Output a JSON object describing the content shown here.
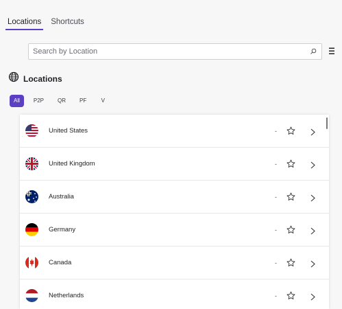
{
  "tabs": [
    {
      "label": "Locations",
      "active": true
    },
    {
      "label": "Shortcuts",
      "active": false
    }
  ],
  "search": {
    "placeholder": "Search by Location",
    "value": ""
  },
  "section": {
    "title": "Locations",
    "icon": "globe-icon"
  },
  "filters": [
    {
      "label": "All",
      "active": true
    },
    {
      "label": "P2P",
      "active": false
    },
    {
      "label": "QR",
      "active": false
    },
    {
      "label": "PF",
      "active": false
    },
    {
      "label": "V",
      "active": false
    }
  ],
  "locations": [
    {
      "name": "United States",
      "status": "-",
      "flag": "us-flag-icon"
    },
    {
      "name": "United Kingdom",
      "status": "-",
      "flag": "uk-flag-icon"
    },
    {
      "name": "Australia",
      "status": "-",
      "flag": "australia-flag-icon"
    },
    {
      "name": "Germany",
      "status": "-",
      "flag": "germany-flag-icon"
    },
    {
      "name": "Canada",
      "status": "-",
      "flag": "canada-flag-icon"
    },
    {
      "name": "Netherlands",
      "status": "-",
      "flag": "netherlands-flag-icon"
    }
  ],
  "colors": {
    "accent": "#5b3fc4",
    "background": "#f7f7f8",
    "panel": "#ffffff",
    "divider": "#e6e6ea"
  }
}
